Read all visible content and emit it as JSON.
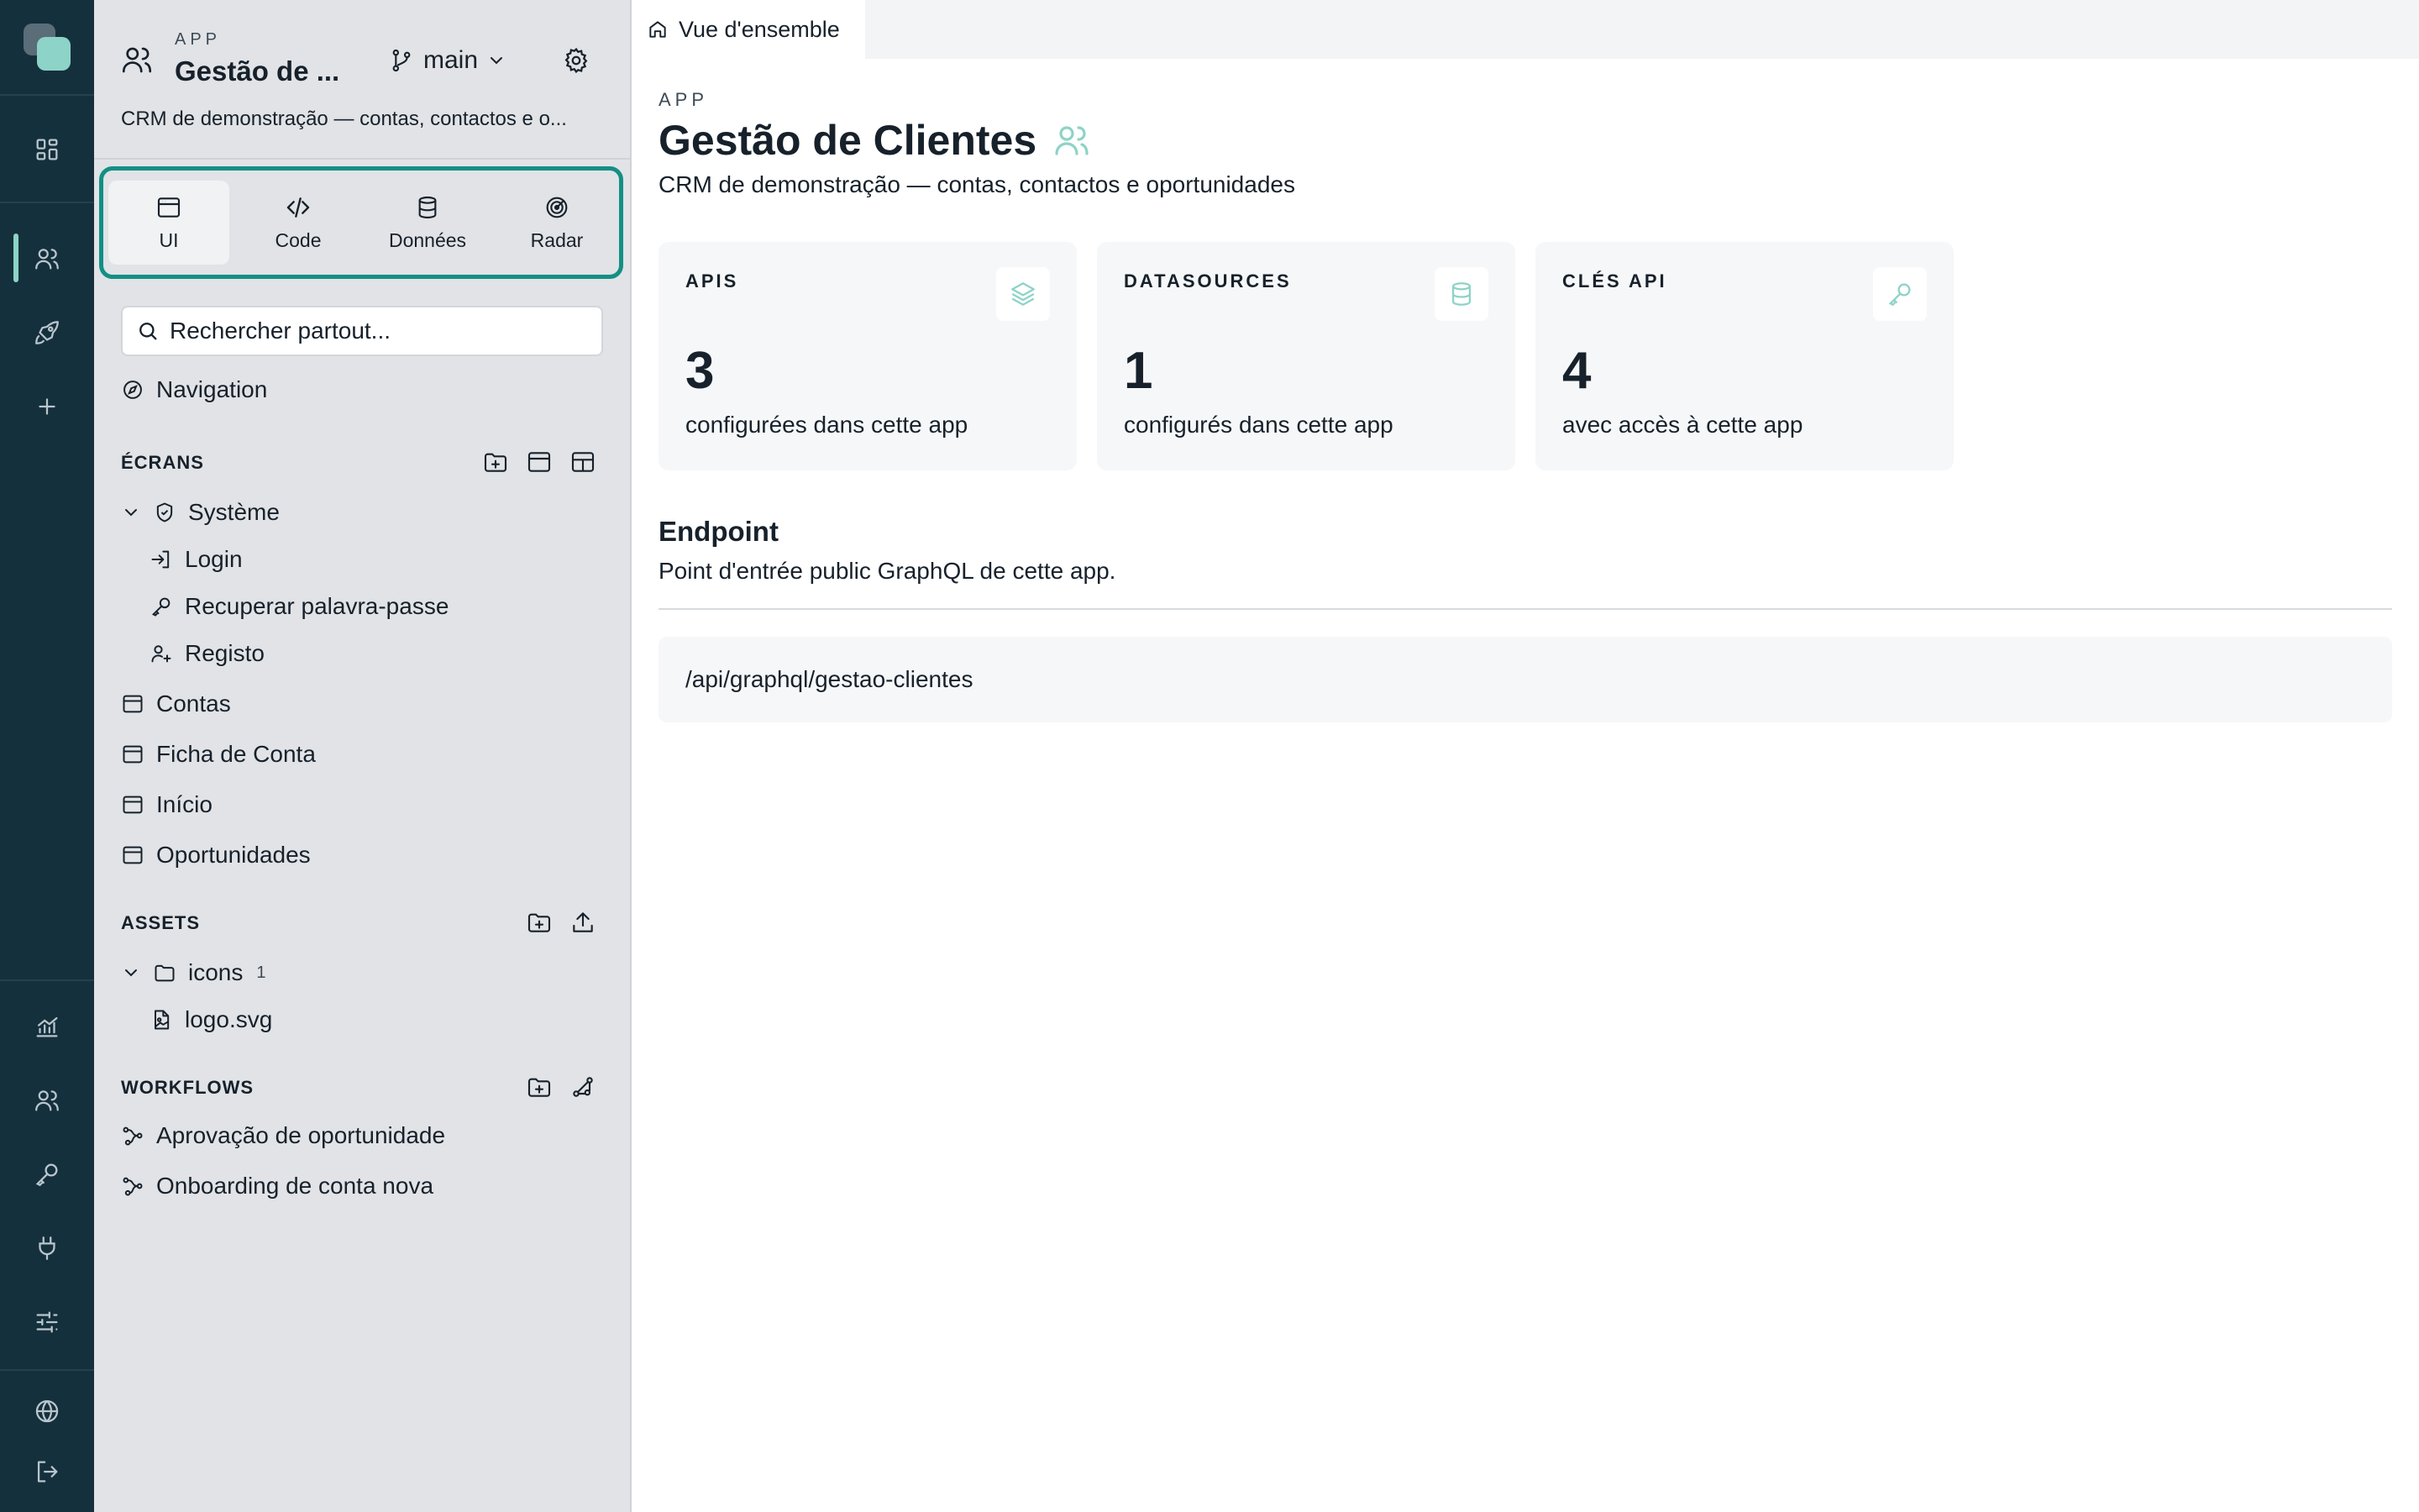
{
  "sidebar": {
    "kicker": "APP",
    "app_name": "Gestão de ...",
    "branch": "main",
    "description": "CRM de demonstração — contas, contactos e o...",
    "tabs": [
      {
        "label": "UI",
        "icon": "window-icon",
        "active": true
      },
      {
        "label": "Code",
        "icon": "code-icon",
        "active": false
      },
      {
        "label": "Données",
        "icon": "database-icon",
        "active": false
      },
      {
        "label": "Radar",
        "icon": "radar-icon",
        "active": false
      }
    ],
    "search_placeholder": "Rechercher partout...",
    "navigation_label": "Navigation",
    "screens": {
      "label": "ÉCRANS",
      "group": {
        "label": "Système",
        "children": [
          "Login",
          "Recuperar palavra-passe",
          "Registo"
        ]
      },
      "items": [
        "Contas",
        "Ficha de Conta",
        "Início",
        "Oportunidades"
      ]
    },
    "assets": {
      "label": "ASSETS",
      "folder": "icons",
      "folder_count": "1",
      "files": [
        "logo.svg"
      ]
    },
    "workflows": {
      "label": "WORKFLOWS",
      "items": [
        "Aprovação de oportunidade",
        "Onboarding de conta nova"
      ]
    }
  },
  "topbar": {
    "tab_label": "Vue d'ensemble"
  },
  "main": {
    "kicker": "APP",
    "title": "Gestão de Clientes",
    "subtitle": "CRM de demonstração — contas, contactos e oportunidades",
    "cards": [
      {
        "label": "APIS",
        "value": "3",
        "caption": "configurées dans cette app",
        "icon": "layers-icon"
      },
      {
        "label": "DATASOURCES",
        "value": "1",
        "caption": "configurés dans cette app",
        "icon": "database-icon"
      },
      {
        "label": "CLÉS API",
        "value": "4",
        "caption": "avec accès à cette app",
        "icon": "key-icon"
      }
    ],
    "endpoint": {
      "title": "Endpoint",
      "subtitle": "Point d'entrée public GraphQL de cette app.",
      "path": "/api/graphql/gestao-clientes"
    }
  },
  "colors": {
    "rail_bg": "#15303d",
    "accent": "#8dd3c7",
    "focus_border": "#148f84",
    "panel_bg": "#e1e3e6"
  }
}
